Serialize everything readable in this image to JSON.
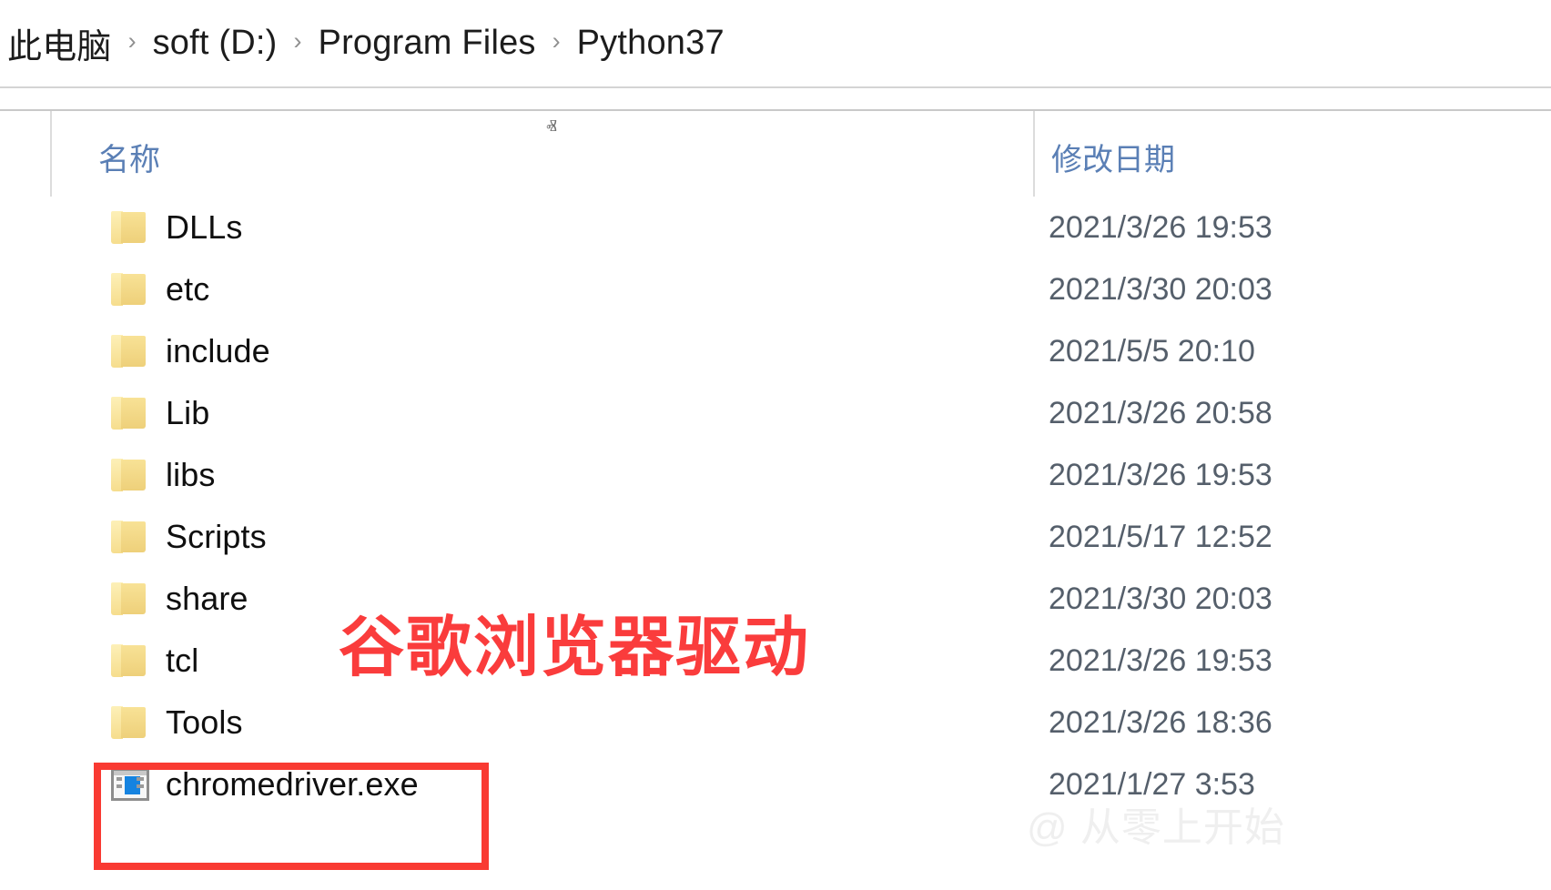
{
  "breadcrumb": {
    "separator": "›",
    "items": [
      {
        "label": "此电脑"
      },
      {
        "label": "soft (D:)"
      },
      {
        "label": "Program Files"
      },
      {
        "label": "Python37"
      }
    ]
  },
  "columns": {
    "name_header": "名称",
    "date_header": "修改日期",
    "sort_caret": "ⱏ"
  },
  "files": [
    {
      "icon": "folder-icon",
      "name": "DLLs",
      "date": "2021/3/26 19:53"
    },
    {
      "icon": "folder-icon",
      "name": "etc",
      "date": "2021/3/30 20:03"
    },
    {
      "icon": "folder-icon",
      "name": "include",
      "date": "2021/5/5 20:10"
    },
    {
      "icon": "folder-icon",
      "name": "Lib",
      "date": "2021/3/26 20:58"
    },
    {
      "icon": "folder-icon",
      "name": "libs",
      "date": "2021/3/26 19:53"
    },
    {
      "icon": "folder-icon",
      "name": "Scripts",
      "date": "2021/5/17 12:52"
    },
    {
      "icon": "folder-icon",
      "name": "share",
      "date": "2021/3/30 20:03"
    },
    {
      "icon": "folder-icon",
      "name": "tcl",
      "date": "2021/3/26 19:53"
    },
    {
      "icon": "folder-icon",
      "name": "Tools",
      "date": "2021/3/26 18:36"
    },
    {
      "icon": "application-icon",
      "name": "chromedriver.exe",
      "date": "2021/1/27 3:53"
    }
  ],
  "annotations": {
    "red_text": "谷歌浏览器驱动",
    "red_color": "#fa3c3c",
    "highlight_target": "chromedriver.exe"
  },
  "watermark": {
    "text": "@ 从零上开始"
  },
  "colors": {
    "header_text": "#5a7fb5",
    "row_text": "#0f0f0f",
    "date_text": "#555f6b",
    "folder": "#f0d183",
    "accent_red": "#f93a32"
  }
}
